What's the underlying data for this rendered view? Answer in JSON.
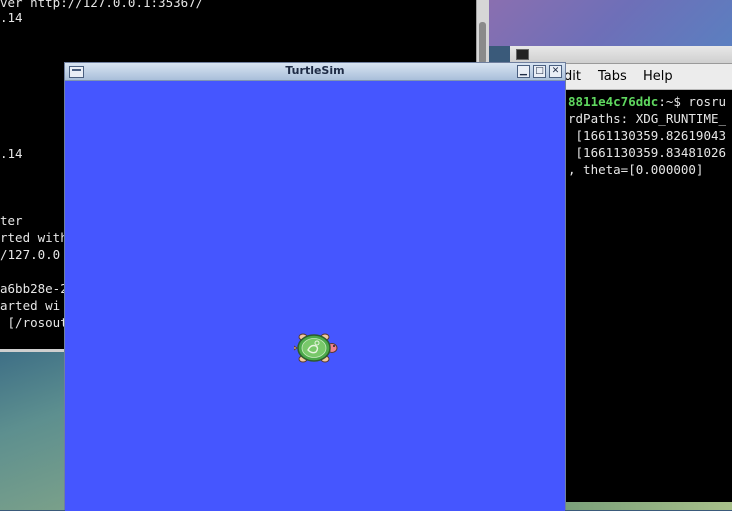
{
  "left_terminal": {
    "lines": [
      "ver http://127.0.0.1:35367/",
      ".14",
      "",
      "",
      "",
      "",
      "",
      "",
      "",
      ".14",
      "",
      "",
      "ter",
      "rted with",
      "/127.0.0",
      "",
      "a6bb28e-2",
      "arted wi",
      " [/rosout"
    ]
  },
  "right_terminal": {
    "menu": [
      "dit",
      "Tabs",
      "Help"
    ],
    "prompt_host": "8811e4c76ddc",
    "prompt_rest": ":~$ rosru",
    "lines": [
      "rdPaths: XDG_RUNTIME_",
      " [1661130359.82619043",
      " [1661130359.83481026",
      ", theta=[0.000000]"
    ]
  },
  "turtlesim": {
    "title": "TurtleSim",
    "minimize": "▁",
    "maximize": "□",
    "close": "✕",
    "background_color": "#4556ff"
  }
}
